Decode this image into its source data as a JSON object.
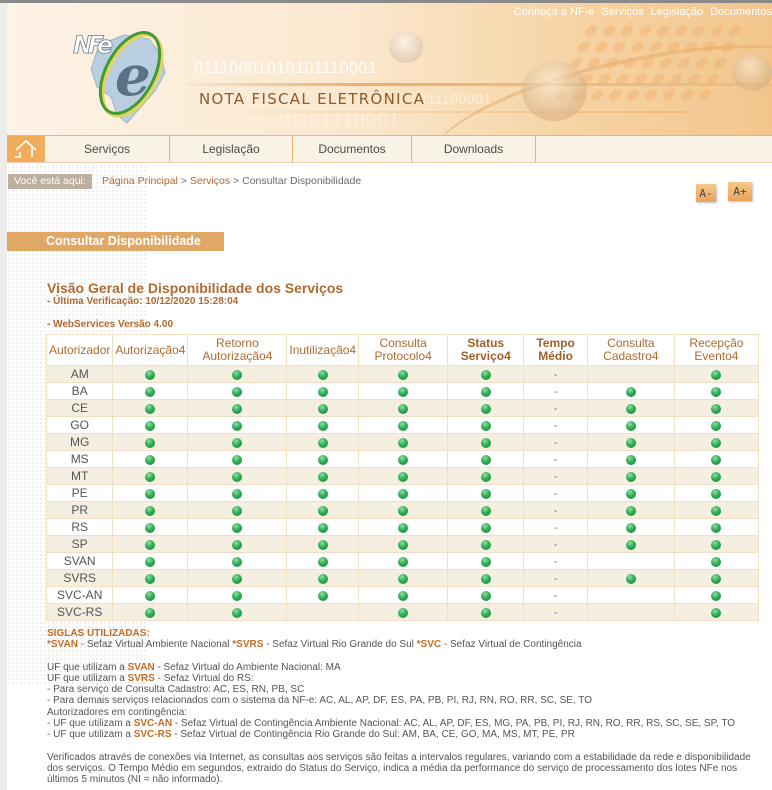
{
  "header": {
    "logo_text": "NFe",
    "title": "NOTA FISCAL ELETRÔNICA",
    "binary_1": "01110001010101110001",
    "binary_2": "0111100001",
    "binary_3": "10101110001",
    "top_links": [
      "Conheça a NF-e",
      "Serviços",
      "Legislação",
      "Documentos"
    ]
  },
  "nav": {
    "home_icon": "home-icon",
    "items": [
      "Serviços",
      "Legislação",
      "Documentos",
      "Downloads"
    ]
  },
  "breadcrumb": {
    "label": "Você está aqui:",
    "items": [
      "Página Principal",
      "Serviços",
      "Consultar Disponibilidade"
    ],
    "separator": ">"
  },
  "font_controls": {
    "decrease": "A-",
    "increase": "A+"
  },
  "page": {
    "section_title": "Consultar Disponibilidade",
    "heading": "Visão Geral de Disponibilidade dos Serviços",
    "last_check": "- Última Verificação: 10/12/2020 15:28:04",
    "version": "- WebServices Versão 4.00"
  },
  "table": {
    "columns": [
      {
        "label": "Autorizador",
        "bold": false
      },
      {
        "label": "Autorização4",
        "bold": false
      },
      {
        "label": "Retorno Autorização4",
        "bold": false
      },
      {
        "label": "Inutilização4",
        "bold": false
      },
      {
        "label": "Consulta Protocolo4",
        "bold": false
      },
      {
        "label": "Status Serviço4",
        "bold": true
      },
      {
        "label": "Tempo Médio",
        "bold": true
      },
      {
        "label": "Consulta Cadastro4",
        "bold": false
      },
      {
        "label": "Recepção Evento4",
        "bold": false
      }
    ],
    "status_legend": {
      "green": "disponível",
      "dash": "-"
    },
    "rows": [
      {
        "autorizador": "AM",
        "autorizacao": "green",
        "retorno": "green",
        "inutilizacao": "green",
        "protocolo": "green",
        "status": "green",
        "tempo": "-",
        "cadastro": "",
        "evento": "green"
      },
      {
        "autorizador": "BA",
        "autorizacao": "green",
        "retorno": "green",
        "inutilizacao": "green",
        "protocolo": "green",
        "status": "green",
        "tempo": "-",
        "cadastro": "green",
        "evento": "green"
      },
      {
        "autorizador": "CE",
        "autorizacao": "green",
        "retorno": "green",
        "inutilizacao": "green",
        "protocolo": "green",
        "status": "green",
        "tempo": "-",
        "cadastro": "green",
        "evento": "green"
      },
      {
        "autorizador": "GO",
        "autorizacao": "green",
        "retorno": "green",
        "inutilizacao": "green",
        "protocolo": "green",
        "status": "green",
        "tempo": "-",
        "cadastro": "green",
        "evento": "green"
      },
      {
        "autorizador": "MG",
        "autorizacao": "green",
        "retorno": "green",
        "inutilizacao": "green",
        "protocolo": "green",
        "status": "green",
        "tempo": "-",
        "cadastro": "green",
        "evento": "green"
      },
      {
        "autorizador": "MS",
        "autorizacao": "green",
        "retorno": "green",
        "inutilizacao": "green",
        "protocolo": "green",
        "status": "green",
        "tempo": "-",
        "cadastro": "green",
        "evento": "green"
      },
      {
        "autorizador": "MT",
        "autorizacao": "green",
        "retorno": "green",
        "inutilizacao": "green",
        "protocolo": "green",
        "status": "green",
        "tempo": "-",
        "cadastro": "green",
        "evento": "green"
      },
      {
        "autorizador": "PE",
        "autorizacao": "green",
        "retorno": "green",
        "inutilizacao": "green",
        "protocolo": "green",
        "status": "green",
        "tempo": "-",
        "cadastro": "green",
        "evento": "green"
      },
      {
        "autorizador": "PR",
        "autorizacao": "green",
        "retorno": "green",
        "inutilizacao": "green",
        "protocolo": "green",
        "status": "green",
        "tempo": "-",
        "cadastro": "green",
        "evento": "green"
      },
      {
        "autorizador": "RS",
        "autorizacao": "green",
        "retorno": "green",
        "inutilizacao": "green",
        "protocolo": "green",
        "status": "green",
        "tempo": "-",
        "cadastro": "green",
        "evento": "green"
      },
      {
        "autorizador": "SP",
        "autorizacao": "green",
        "retorno": "green",
        "inutilizacao": "green",
        "protocolo": "green",
        "status": "green",
        "tempo": "-",
        "cadastro": "green",
        "evento": "green"
      },
      {
        "autorizador": "SVAN",
        "autorizacao": "green",
        "retorno": "green",
        "inutilizacao": "green",
        "protocolo": "green",
        "status": "green",
        "tempo": "-",
        "cadastro": "",
        "evento": "green"
      },
      {
        "autorizador": "SVRS",
        "autorizacao": "green",
        "retorno": "green",
        "inutilizacao": "green",
        "protocolo": "green",
        "status": "green",
        "tempo": "-",
        "cadastro": "green",
        "evento": "green"
      },
      {
        "autorizador": "SVC-AN",
        "autorizacao": "green",
        "retorno": "green",
        "inutilizacao": "green",
        "protocolo": "green",
        "status": "green",
        "tempo": "-",
        "cadastro": "",
        "evento": "green"
      },
      {
        "autorizador": "SVC-RS",
        "autorizacao": "green",
        "retorno": "green",
        "inutilizacao": "",
        "protocolo": "green",
        "status": "green",
        "tempo": "-",
        "cadastro": "",
        "evento": "green"
      }
    ]
  },
  "notes": {
    "siglas_title": "SIGLAS UTILIZADAS:",
    "siglas": [
      {
        "key": "*SVAN",
        "text": " - Sefaz Virtual Ambiente Nacional "
      },
      {
        "key": "*SVRS",
        "text": " - Sefaz Virtual Rio Grande do Sul "
      },
      {
        "key": "*SVC",
        "text": " - Sefaz Virtual de Contingência"
      }
    ],
    "svan_prefix": "UF que utilizam a ",
    "svan_key": "SVAN",
    "svan_text": " - Sefaz Virtual do Ambiente Nacional: MA",
    "svrs_prefix": "UF que utilizam a ",
    "svrs_key": "SVRS",
    "svrs_text": " - Sefaz Virtual do RS:",
    "svrs_cadastro": "- Para serviço de Consulta Cadastro: AC, ES, RN, PB, SC",
    "svrs_demais": "- Para demais serviços relacionados com o sistema da NF-e: AC, AL, AP, DF, ES, PA, PB, PI, RJ, RN, RO, RR, SC, SE, TO",
    "contingencia_title": "Autorizadores em contingência:",
    "svcan_prefix": "- UF que utilizam a ",
    "svcan_key": "SVC-AN",
    "svcan_text": " - Sefaz Virtual de Contingência Ambiente Nacional: AC, AL, AP, DF, ES, MG, PA, PB, PI, RJ, RN, RO, RR, RS, SC, SE, SP, TO",
    "svcrs_prefix": "- UF que utilizam a ",
    "svcrs_key": "SVC-RS",
    "svcrs_text": " - Sefaz Virtual de Contingência Rio Grande do Sul: AM, BA, CE, GO, MA, MS, MT, PE, PR",
    "disclaimer": "Verificados através de conexões via Internet, as consultas aos serviços são feitas a intervalos regulares, variando com a estabilidade da rede e disponibilidade dos serviços. O Tempo Médio em segundos, extraido do Status do Serviço, indica a média da performance do serviço de processamento dos lotes NFe nos últimos 5 minutos (NI = não informado)."
  },
  "colors": {
    "accent_orange": "#e1a764",
    "heading_brown": "#b16a2f",
    "highlight_orange": "#c86b22",
    "status_green": "#2fae55",
    "row_alt": "#f5efe2"
  }
}
